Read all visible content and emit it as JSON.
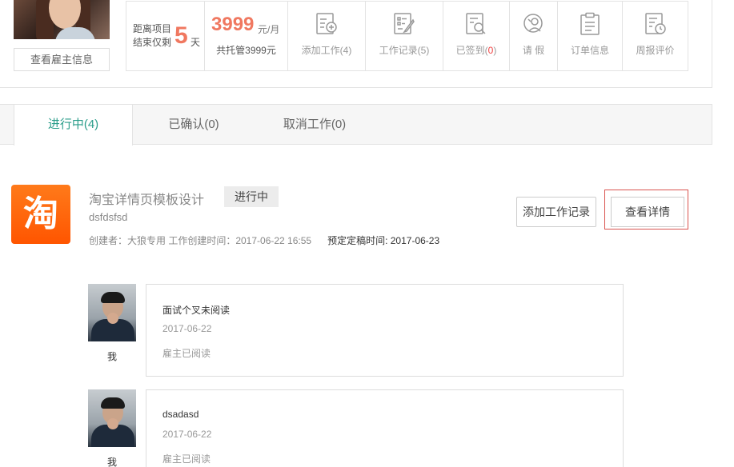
{
  "employer": {
    "view_info_label": "查看雇主信息"
  },
  "stats": {
    "deadline_label_1": "距离项目",
    "deadline_label_2": "结束仅剩",
    "days": "5",
    "days_unit": "天",
    "price": "3999",
    "price_unit": "元/月",
    "escrow": "共托管3999元"
  },
  "actions": [
    {
      "label": "添加工作(4)",
      "icon": "add-document-icon"
    },
    {
      "label": "工作记录(5)",
      "icon": "edit-list-icon"
    },
    {
      "label_prefix": "已签到(",
      "count": "0",
      "label_suffix": ")",
      "icon": "search-document-icon",
      "count_color": "#f04040"
    },
    {
      "label": "请 假",
      "icon": "person-clock-icon"
    },
    {
      "label": "订单信息",
      "icon": "clipboard-icon"
    },
    {
      "label": "周报评价",
      "icon": "weekly-report-icon"
    }
  ],
  "tabs": [
    {
      "label": "进行中(4)",
      "active": true
    },
    {
      "label": "已确认(0)",
      "active": false
    },
    {
      "label": "取消工作(0)",
      "active": false
    }
  ],
  "order": {
    "logo_glyph": "淘",
    "title": "淘宝详情页模板设计",
    "status": "进行中",
    "subtitle": "dsfdsfsd",
    "creator_line": "创建者：大狼专用 工作创建时间：2017-06-22 16:55",
    "deadline_line": "预定定稿时间: 2017-06-23",
    "add_log_label": "添加工作记录",
    "detail_label": "查看详情"
  },
  "logs": [
    {
      "author": "我",
      "content": "面试个叉未阅读",
      "date": "2017-06-22",
      "read_status": "雇主已阅读"
    },
    {
      "author": "我",
      "content": "dsadasd",
      "date": "2017-06-22",
      "read_status": "雇主已阅读"
    }
  ],
  "colors": {
    "accent": "#2a9d8a",
    "highlight": "#f07860",
    "alert": "#f04040"
  }
}
